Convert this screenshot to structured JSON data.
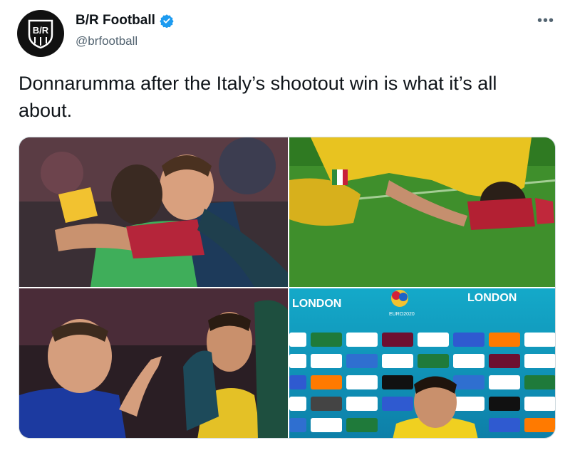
{
  "tweet": {
    "display_name": "B/R Football",
    "handle": "@brfootball",
    "avatar_text": "B/R",
    "more_label": "•••",
    "text": "Donnarumma after the Italy’s shootout win is what it’s all about.",
    "verified": true,
    "accent_color": "#1d9bf0"
  },
  "photos": {
    "p1": {
      "icon": "photo-hug"
    },
    "p2": {
      "icon": "photo-kneeling"
    },
    "p3": {
      "icon": "photo-pointing"
    },
    "p4": {
      "icon": "photo-press-board",
      "board_title_left": "LONDON",
      "board_title_right": "LONDON",
      "badge": "EURO2020"
    }
  }
}
